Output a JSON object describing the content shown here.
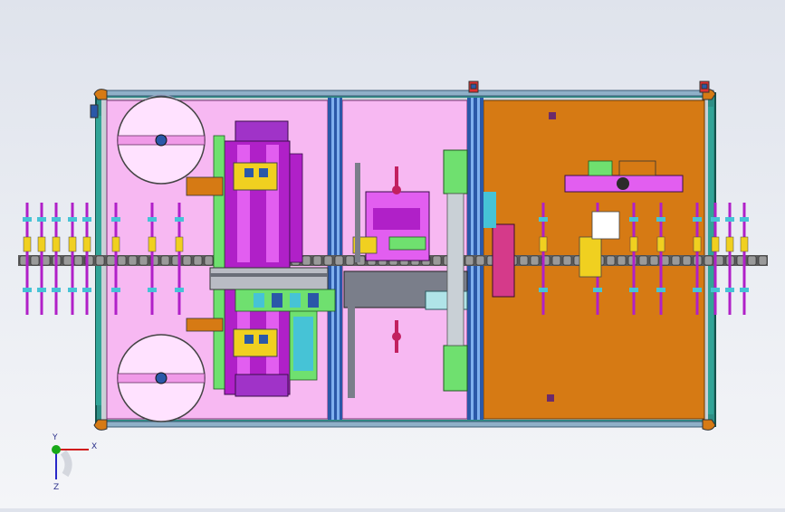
{
  "viewport": {
    "background_top": "#dfe3ec",
    "background_bottom": "#f4f5f8"
  },
  "machine": {
    "frame_color": "#1f7a70",
    "left_zone_color": "#f7b8f2",
    "right_zone_color": "#d67a14",
    "slide_rail_color": "#2a58a8",
    "chain_color": "#2b2b2b",
    "magenta": "#b020c8",
    "lime": "#6fe06f",
    "cyan": "#46c3d6",
    "yellow": "#f0d020"
  },
  "axis_triad": {
    "x_label": "X",
    "y_label": "Y",
    "z_label": "Z",
    "x_color": "#d01818",
    "y_color": "#18a818",
    "z_color": "#2828c8"
  }
}
